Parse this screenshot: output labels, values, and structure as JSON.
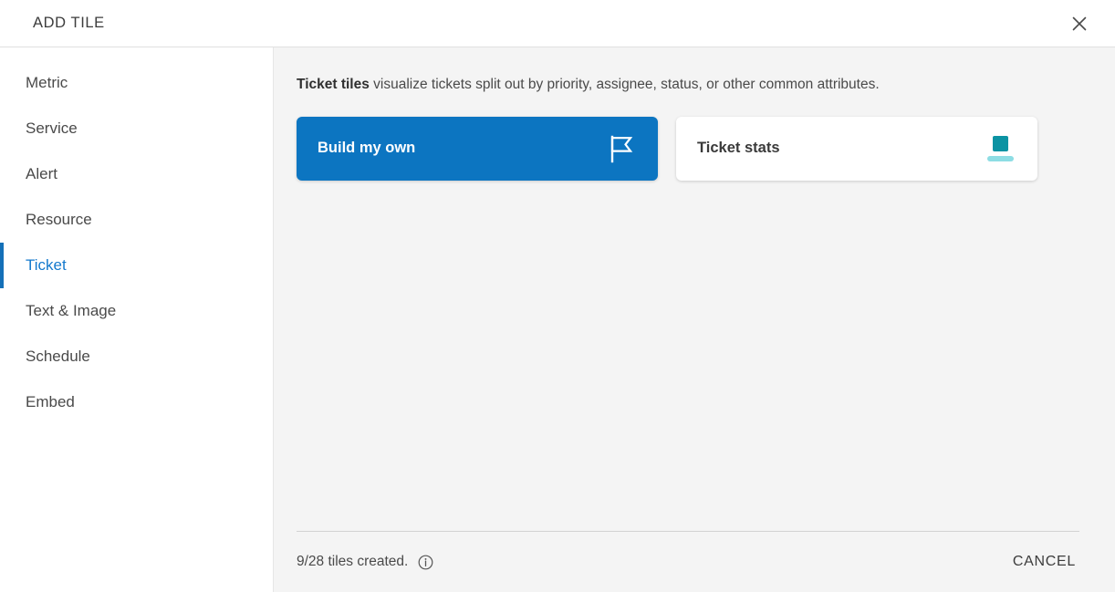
{
  "header": {
    "title": "ADD TILE",
    "close_icon": "close-icon"
  },
  "sidebar": {
    "items": [
      {
        "label": "Metric",
        "active": false
      },
      {
        "label": "Service",
        "active": false
      },
      {
        "label": "Alert",
        "active": false
      },
      {
        "label": "Resource",
        "active": false
      },
      {
        "label": "Ticket",
        "active": true
      },
      {
        "label": "Text & Image",
        "active": false
      },
      {
        "label": "Schedule",
        "active": false
      },
      {
        "label": "Embed",
        "active": false
      }
    ]
  },
  "main": {
    "description_bold": "Ticket tiles",
    "description_rest": " visualize tickets split out by priority, assignee, status, or other common attributes.",
    "tiles": [
      {
        "label": "Build my own",
        "icon": "flag-icon",
        "style": "primary"
      },
      {
        "label": "Ticket stats",
        "icon": "stats-tile-icon",
        "style": "plain"
      }
    ]
  },
  "footer": {
    "tiles_created": "9/28 tiles created.",
    "info_icon": "info-icon",
    "cancel_label": "CANCEL"
  },
  "colors": {
    "accent_blue": "#0c75c1",
    "active_nav_blue": "#1479cd",
    "teal_dark": "#0b93a3",
    "teal_light": "#8ddde4",
    "panel_bg": "#f4f4f4",
    "sidebar_bg": "#ffffff"
  }
}
